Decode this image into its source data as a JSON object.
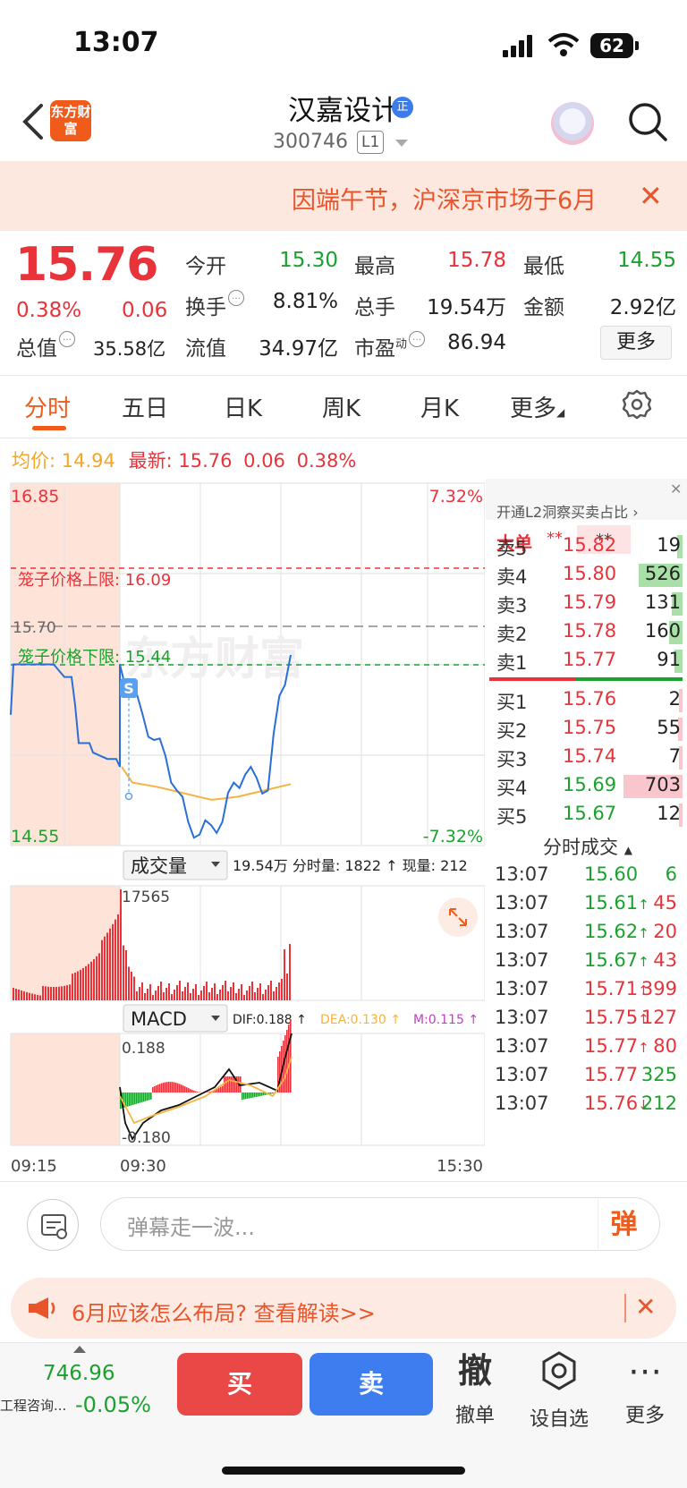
{
  "status_bar": {
    "time": "13:07",
    "battery": "62"
  },
  "header": {
    "logo_text": "东方财富",
    "stock_name": "汉嘉设计",
    "name_badge": "正",
    "stock_code": "300746",
    "level_badge": "L1"
  },
  "notice": {
    "text": "因端午节，沪深京市场于6月"
  },
  "quote": {
    "price": "15.76",
    "change_pct": "0.38%",
    "change": "0.06",
    "fields": {
      "open_label": "今开",
      "open": "15.30",
      "high_label": "最高",
      "high": "15.78",
      "low_label": "最低",
      "low": "14.55",
      "turnover_label": "换手",
      "turnover": "8.81%",
      "volume_label": "总手",
      "volume": "19.54万",
      "amount_label": "金额",
      "amount": "2.92亿",
      "mktcap_label": "总值",
      "mktcap": "35.58亿",
      "float_label": "流值",
      "float": "34.97亿",
      "pe_label": "市盈",
      "pe_super": "动",
      "pe": "86.94"
    },
    "more_button": "更多"
  },
  "tabs": [
    "分时",
    "五日",
    "日K",
    "周K",
    "月K",
    "更多"
  ],
  "avg_line": {
    "avg_label": "均价:",
    "avg": "14.94",
    "latest_label": "最新:",
    "latest": "15.76",
    "change": "0.06",
    "change_pct": "0.38%"
  },
  "chart": {
    "y_max": "16.85",
    "y_min": "14.55",
    "pct_max": "7.32%",
    "pct_min": "-7.32%",
    "upper_limit_label": "笼子价格上限: 16.09",
    "lower_limit_label": "笼子价格下限: 15.44",
    "ref_price_label": "15.70",
    "watermark": "东方财富",
    "s_marker": "S",
    "volume_selector": "成交量",
    "volume_info": "19.54万 分时量: 1822 ↑ 现量: 212",
    "volume_peak": "17565",
    "macd_selector": "MACD",
    "dif": "DIF:0.188 ↑",
    "dea": "DEA:0.130 ↑",
    "m": "M:0.115 ↑",
    "macd_max": "0.188",
    "macd_min": "-0.180",
    "time_start": "09:15",
    "time_open": "09:30",
    "time_end": "15:30",
    "colors": {
      "up": "#e8333b",
      "down": "#19a22d",
      "price_line": "#2a6fd6",
      "avg_line": "#f5b340",
      "preopen": "#fde3d8"
    }
  },
  "chart_data": {
    "type": "line",
    "title": "",
    "x_range": [
      "09:15",
      "15:30"
    ],
    "ylim": [
      14.55,
      16.85
    ],
    "series": [
      {
        "name": "最新",
        "values": [
          15.7,
          15.52,
          15.38,
          15.22,
          15.12,
          14.9,
          14.7,
          14.62,
          14.68,
          14.7,
          14.95,
          15.0,
          14.98,
          14.9,
          15.5,
          15.76
        ]
      },
      {
        "name": "均价",
        "values": [
          14.95,
          14.92,
          14.88,
          14.84,
          14.86,
          14.9,
          14.94
        ]
      }
    ],
    "reference_lines": [
      {
        "label": "笼子价格上限",
        "value": 16.09
      },
      {
        "label": "笼子价格下限",
        "value": 15.44
      },
      {
        "label": "",
        "value": 15.7
      }
    ]
  },
  "order_book": {
    "banner": "开通L2洞察买卖占比",
    "big_order_label": "大单",
    "big_order_val1": "**",
    "big_order_val2": "**",
    "asks": [
      {
        "label": "卖5",
        "price": "15.82",
        "vol": "19"
      },
      {
        "label": "卖4",
        "price": "15.80",
        "vol": "526"
      },
      {
        "label": "卖3",
        "price": "15.79",
        "vol": "131"
      },
      {
        "label": "卖2",
        "price": "15.78",
        "vol": "160"
      },
      {
        "label": "卖1",
        "price": "15.77",
        "vol": "91"
      }
    ],
    "bids": [
      {
        "label": "买1",
        "price": "15.76",
        "vol": "2"
      },
      {
        "label": "买2",
        "price": "15.75",
        "vol": "55"
      },
      {
        "label": "买3",
        "price": "15.74",
        "vol": "7"
      },
      {
        "label": "买4",
        "price": "15.69",
        "vol": "703"
      },
      {
        "label": "买5",
        "price": "15.67",
        "vol": "12"
      }
    ],
    "trades_title": "分时成交",
    "trades": [
      {
        "t": "13:07",
        "p": "15.60",
        "a": "",
        "v": "6"
      },
      {
        "t": "13:07",
        "p": "15.61",
        "a": "↑",
        "v": "45"
      },
      {
        "t": "13:07",
        "p": "15.62",
        "a": "↑",
        "v": "20"
      },
      {
        "t": "13:07",
        "p": "15.67",
        "a": "↑",
        "v": "43"
      },
      {
        "t": "13:07",
        "p": "15.71",
        "a": "↑",
        "v": "399"
      },
      {
        "t": "13:07",
        "p": "15.75",
        "a": "↑",
        "v": "127"
      },
      {
        "t": "13:07",
        "p": "15.77",
        "a": "↑",
        "v": "80"
      },
      {
        "t": "13:07",
        "p": "15.77",
        "a": "",
        "v": "325"
      },
      {
        "t": "13:07",
        "p": "15.76",
        "a": "↓",
        "v": "212"
      }
    ]
  },
  "danmu": {
    "placeholder": "弹幕走一波...",
    "button": "弹"
  },
  "promo": {
    "text": "6月应该怎么布局? 查看解读>>"
  },
  "bottom_bar": {
    "index_value": "746.96",
    "index_name": "工程咨询...",
    "index_pct": "-0.05%",
    "buy": "买",
    "sell": "卖",
    "cancel_icon_char": "撤",
    "cancel": "撤单",
    "watch": "设自选",
    "more": "更多"
  }
}
